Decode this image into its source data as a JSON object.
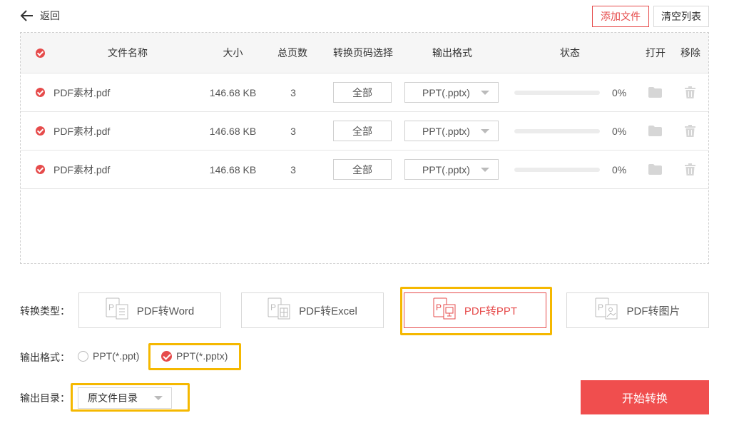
{
  "header": {
    "back_label": "返回",
    "add_file_label": "添加文件",
    "clear_list_label": "清空列表"
  },
  "table": {
    "columns": {
      "name": "文件名称",
      "size": "大小",
      "pages": "总页数",
      "page_select": "转换页码选择",
      "format": "输出格式",
      "status": "状态",
      "open": "打开",
      "remove": "移除"
    },
    "rows": [
      {
        "name": "PDF素材.pdf",
        "size": "146.68 KB",
        "pages": "3",
        "page_select": "全部",
        "format": "PPT(.pptx)",
        "progress_text": "0%",
        "progress": 0
      },
      {
        "name": "PDF素材.pdf",
        "size": "146.68 KB",
        "pages": "3",
        "page_select": "全部",
        "format": "PPT(.pptx)",
        "progress_text": "0%",
        "progress": 0
      },
      {
        "name": "PDF素材.pdf",
        "size": "146.68 KB",
        "pages": "3",
        "page_select": "全部",
        "format": "PPT(.pptx)",
        "progress_text": "0%",
        "progress": 0
      }
    ]
  },
  "conversion": {
    "type_label": "转换类型：",
    "types": [
      {
        "label": "PDF转Word",
        "icon": "pdf-to-word-icon"
      },
      {
        "label": "PDF转Excel",
        "icon": "pdf-to-excel-icon"
      },
      {
        "label": "PDF转PPT",
        "icon": "pdf-to-ppt-icon",
        "selected": true
      },
      {
        "label": "PDF转图片",
        "icon": "pdf-to-image-icon"
      }
    ],
    "format_label": "输出格式：",
    "formats": [
      {
        "label": "PPT(*.ppt)",
        "checked": false
      },
      {
        "label": "PPT(*.pptx)",
        "checked": true
      }
    ],
    "dir_label": "输出目录：",
    "dir_value": "原文件目录",
    "start_label": "开始转换"
  },
  "colors": {
    "accent": "#e64b4b",
    "highlight": "#f5b800",
    "start_button": "#f04e4e"
  }
}
